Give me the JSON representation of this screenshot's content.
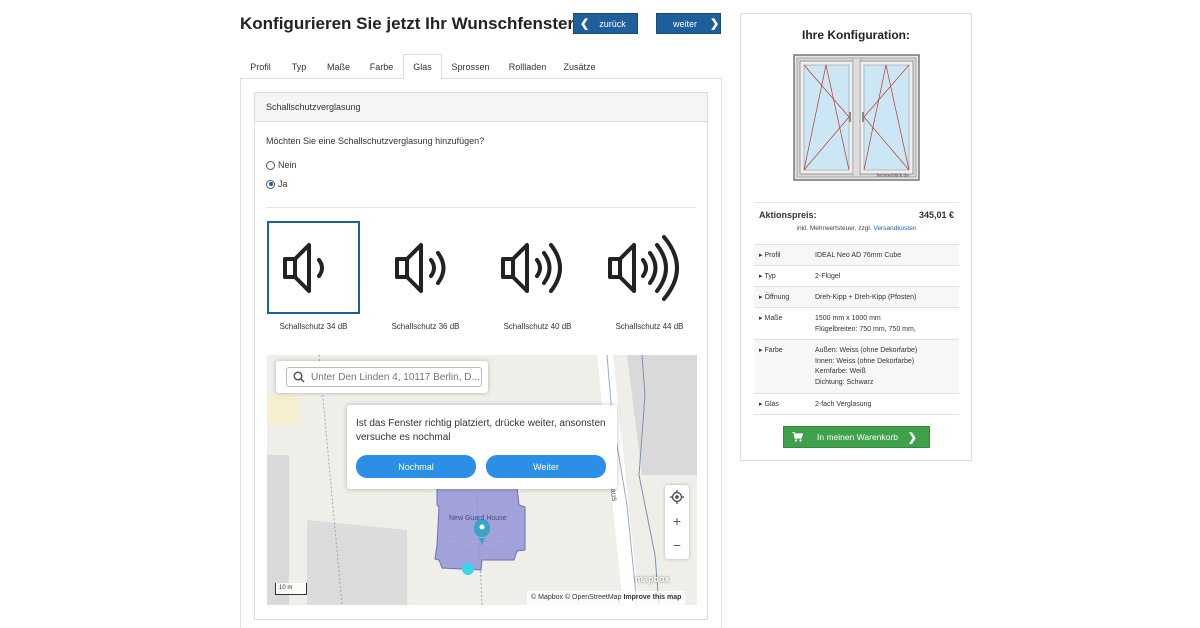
{
  "header": {
    "title": "Konfigurieren Sie jetzt Ihr Wunschfenster",
    "back_label": "zurück",
    "next_label": "weiter"
  },
  "tabs": [
    {
      "label": "Profil"
    },
    {
      "label": "Typ"
    },
    {
      "label": "Maße"
    },
    {
      "label": "Farbe"
    },
    {
      "label": "Glas"
    },
    {
      "label": "Sprossen"
    },
    {
      "label": "Rollladen"
    },
    {
      "label": "Zusätze"
    }
  ],
  "active_tab": "Glas",
  "glass": {
    "section_title": "Schallschutzverglasung",
    "question": "Möchten Sie eine Schallschutzverglasung hinzufügen?",
    "option_no": "Nein",
    "option_yes": "Ja",
    "selected_option": "Ja",
    "sound_options": [
      {
        "label": "Schallschutz 34 dB",
        "icon": "speaker-1-wave-icon"
      },
      {
        "label": "Schallschutz 36 dB",
        "icon": "speaker-2-wave-icon"
      },
      {
        "label": "Schallschutz 40 dB",
        "icon": "speaker-3-wave-icon"
      },
      {
        "label": "Schallschutz 44 dB",
        "icon": "speaker-4-wave-icon"
      }
    ],
    "selected_sound": "Schallschutz 34 dB"
  },
  "map": {
    "search_placeholder": "Unter Den Linden 4, 10117 Berlin, D...",
    "popup_text": "Ist das Fenster richtig platziert, drücke weiter, ansonsten versuche es nochmal",
    "btn_retry": "Nochmal",
    "btn_continue": "Weiter",
    "street_label": "Hinter dem Gießhaus",
    "house_label": "New Guard House",
    "scale_label": "10 m",
    "logo": "mapbox",
    "attribution_1": "© Mapbox © OpenStreetMap",
    "attribution_2": "Improve this map",
    "zoom_in": "+",
    "zoom_out": "−"
  },
  "config": {
    "title": "Ihre Konfiguration:",
    "price_label": "Aktionspreis:",
    "price_value": "345,01 €",
    "tax_note": "inkl. Mehrwertsteuer, zzgl.",
    "shipping_link": "Versandkosten",
    "image_watermark": "fensterblick.de",
    "specs": [
      {
        "key": "Profil",
        "lines": [
          "IDEAL Neo AD 76mm Cube"
        ]
      },
      {
        "key": "Typ",
        "lines": [
          "2-Flügel"
        ]
      },
      {
        "key": "Öffnung",
        "lines": [
          "Dreh-Kipp + Dreh-Kipp (Pfosten)"
        ]
      },
      {
        "key": "Maße",
        "lines": [
          "1500 mm x 1000 mm",
          "Flügelbreiten: 750 mm, 750 mm,"
        ]
      },
      {
        "key": "Farbe",
        "lines": [
          "Außen: Weiss (ohne Dekorfarbe)",
          "Innen: Weiss (ohne Dekorfarbe)",
          "Kernfarbe: Weiß",
          "Dichtung: Schwarz"
        ]
      },
      {
        "key": "Glas",
        "lines": [
          "2-fach Verglasung"
        ]
      }
    ],
    "cart_label": "In meinen Warenkorb"
  },
  "colors": {
    "primary_blue": "#1e5f9c",
    "cart_green": "#3fa14a",
    "map_button_blue": "#2b8fe6",
    "building_purple": "#8f8fd6"
  }
}
